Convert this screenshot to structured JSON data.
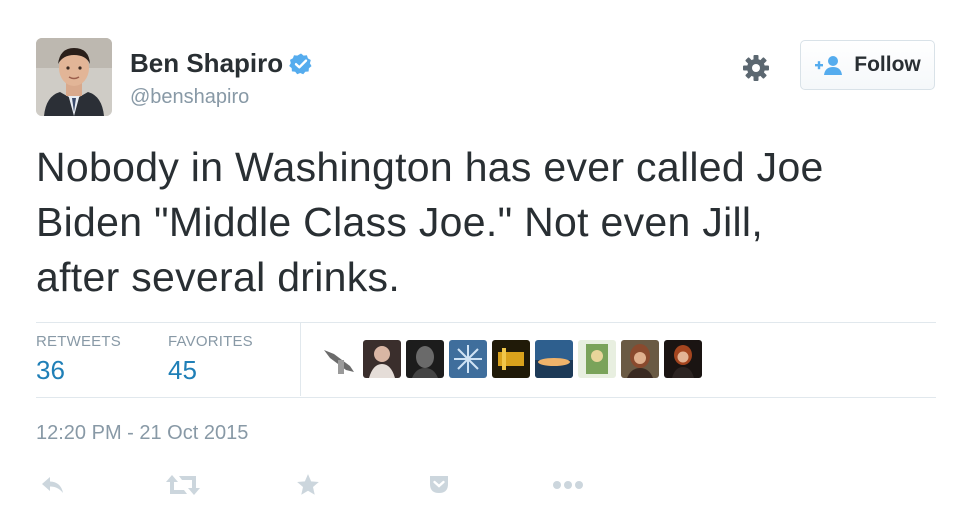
{
  "user": {
    "name": "Ben Shapiro",
    "handle": "@benshapiro",
    "verified": true
  },
  "follow_button": {
    "label": "Follow"
  },
  "tweet": {
    "lines": [
      "Nobody in Washington has ever called Joe",
      "Biden \"Middle Class Joe.\" Not even Jill,",
      "after several drinks."
    ]
  },
  "stats": {
    "retweets_label": "RETWEETS",
    "retweets_value": "36",
    "favorites_label": "FAVORITES",
    "favorites_value": "45"
  },
  "timestamp": "12:20 PM - 21 Oct 2015",
  "favoriters_count_shown": 9,
  "colors": {
    "link_blue": "#1f7fb7",
    "text": "#292f33",
    "muted": "#8899a6",
    "verified_blue": "#55acee",
    "divider": "#e1e8ed"
  },
  "icons": {
    "actions": [
      "reply-icon",
      "retweet-icon",
      "favorite-star-icon",
      "pocket-icon",
      "more-dots-icon"
    ],
    "header": [
      "verified-badge-icon",
      "gear-icon",
      "follow-person-plus-icon"
    ]
  }
}
